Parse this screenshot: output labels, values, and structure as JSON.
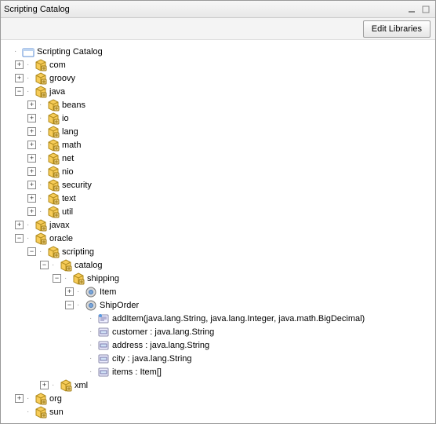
{
  "window": {
    "title": "Scripting Catalog"
  },
  "toolbar": {
    "editLibraries": "Edit Libraries"
  },
  "tree": {
    "root": {
      "label": "Scripting Catalog",
      "expanded": true,
      "icon": "root",
      "children": [
        {
          "label": "com",
          "icon": "package",
          "expanded": false,
          "hasChildren": true
        },
        {
          "label": "groovy",
          "icon": "package",
          "expanded": false,
          "hasChildren": true
        },
        {
          "label": "java",
          "icon": "package",
          "expanded": true,
          "hasChildren": true,
          "children": [
            {
              "label": "beans",
              "icon": "package",
              "expanded": false,
              "hasChildren": true
            },
            {
              "label": "io",
              "icon": "package",
              "expanded": false,
              "hasChildren": true
            },
            {
              "label": "lang",
              "icon": "package",
              "expanded": false,
              "hasChildren": true
            },
            {
              "label": "math",
              "icon": "package",
              "expanded": false,
              "hasChildren": true
            },
            {
              "label": "net",
              "icon": "package",
              "expanded": false,
              "hasChildren": true
            },
            {
              "label": "nio",
              "icon": "package",
              "expanded": false,
              "hasChildren": true
            },
            {
              "label": "security",
              "icon": "package",
              "expanded": false,
              "hasChildren": true
            },
            {
              "label": "text",
              "icon": "package",
              "expanded": false,
              "hasChildren": true
            },
            {
              "label": "util",
              "icon": "package",
              "expanded": false,
              "hasChildren": true
            }
          ]
        },
        {
          "label": "javax",
          "icon": "package",
          "expanded": false,
          "hasChildren": true
        },
        {
          "label": "oracle",
          "icon": "package",
          "expanded": true,
          "hasChildren": true,
          "children": [
            {
              "label": "scripting",
              "icon": "package",
              "expanded": true,
              "hasChildren": true,
              "children": [
                {
                  "label": "catalog",
                  "icon": "package",
                  "expanded": true,
                  "hasChildren": true,
                  "children": [
                    {
                      "label": "shipping",
                      "icon": "package",
                      "expanded": true,
                      "hasChildren": true,
                      "children": [
                        {
                          "label": "Item",
                          "icon": "class",
                          "expanded": false,
                          "hasChildren": true
                        },
                        {
                          "label": "ShipOrder",
                          "icon": "class",
                          "expanded": true,
                          "hasChildren": true,
                          "children": [
                            {
                              "label": "addItem(java.lang.String, java.lang.Integer, java.math.BigDecimal)",
                              "icon": "method",
                              "hasChildren": false
                            },
                            {
                              "label": "customer : java.lang.String",
                              "icon": "field",
                              "hasChildren": false
                            },
                            {
                              "label": "address : java.lang.String",
                              "icon": "field",
                              "hasChildren": false
                            },
                            {
                              "label": "city : java.lang.String",
                              "icon": "field",
                              "hasChildren": false
                            },
                            {
                              "label": "items : Item[]",
                              "icon": "field",
                              "hasChildren": false
                            }
                          ]
                        }
                      ]
                    }
                  ]
                },
                {
                  "label": "xml",
                  "icon": "package",
                  "expanded": false,
                  "hasChildren": true
                }
              ]
            }
          ]
        },
        {
          "label": "org",
          "icon": "package",
          "expanded": false,
          "hasChildren": true
        },
        {
          "label": "sun",
          "icon": "package",
          "expanded": false,
          "hasChildren": false
        }
      ]
    }
  }
}
